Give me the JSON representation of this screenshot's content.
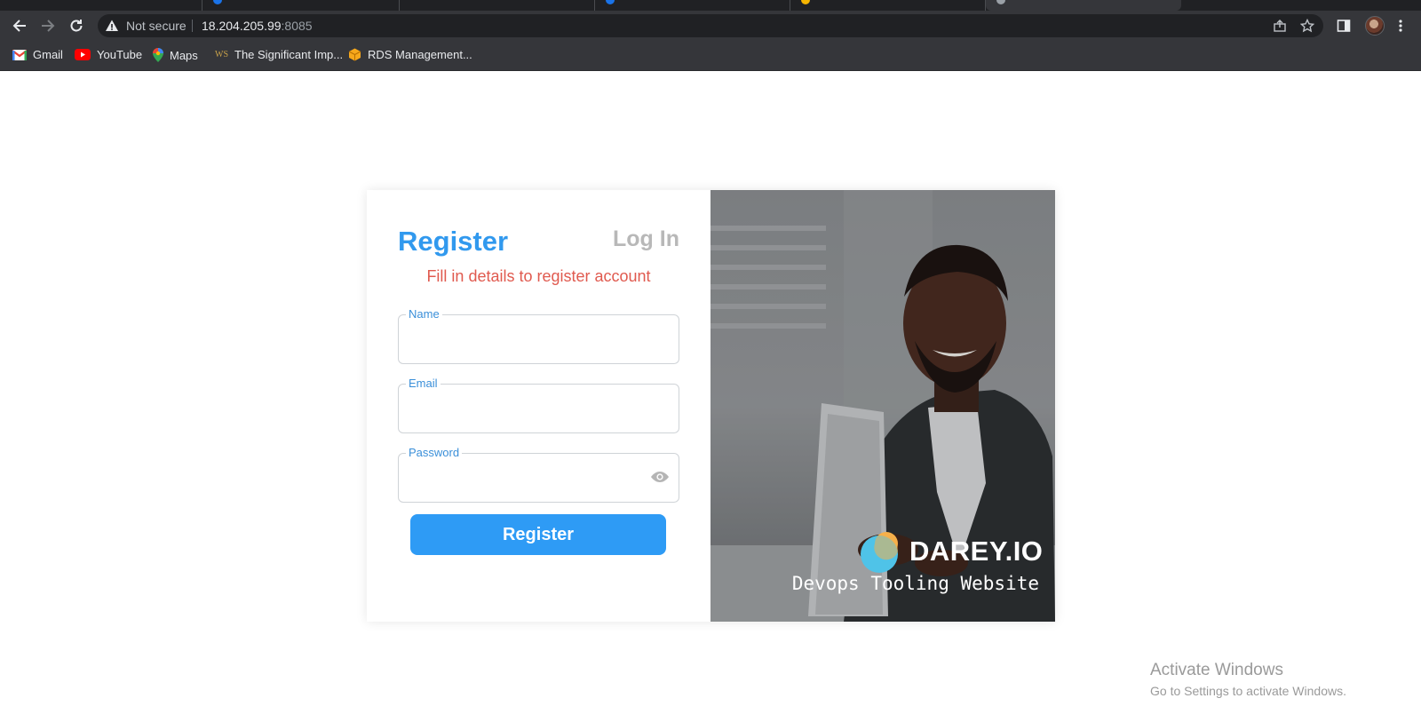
{
  "browser": {
    "security_label": "Not secure",
    "url_host": "18.204.205.99",
    "url_port": ":8085",
    "bookmarks": [
      {
        "label": "Gmail",
        "icon": "gmail-icon"
      },
      {
        "label": "YouTube",
        "icon": "youtube-icon"
      },
      {
        "label": "Maps",
        "icon": "maps-icon"
      },
      {
        "label": "The Significant Imp...",
        "icon": "ws-icon"
      },
      {
        "label": "RDS Management...",
        "icon": "aws-icon"
      }
    ]
  },
  "form": {
    "register_tab": "Register",
    "login_tab": "Log In",
    "subtitle": "Fill in details to register account",
    "fields": {
      "name_label": "Name",
      "email_label": "Email",
      "password_label": "Password"
    },
    "submit_label": "Register"
  },
  "promo": {
    "brand": "DAREY.IO",
    "tagline": "Devops Tooling Website"
  },
  "windows_notice": {
    "title": "Activate Windows",
    "subtitle": "Go to Settings to activate Windows."
  },
  "colors": {
    "accent": "#2e9bf5",
    "subtitle_red": "#e05a4f",
    "chrome_dark": "#35363a"
  }
}
